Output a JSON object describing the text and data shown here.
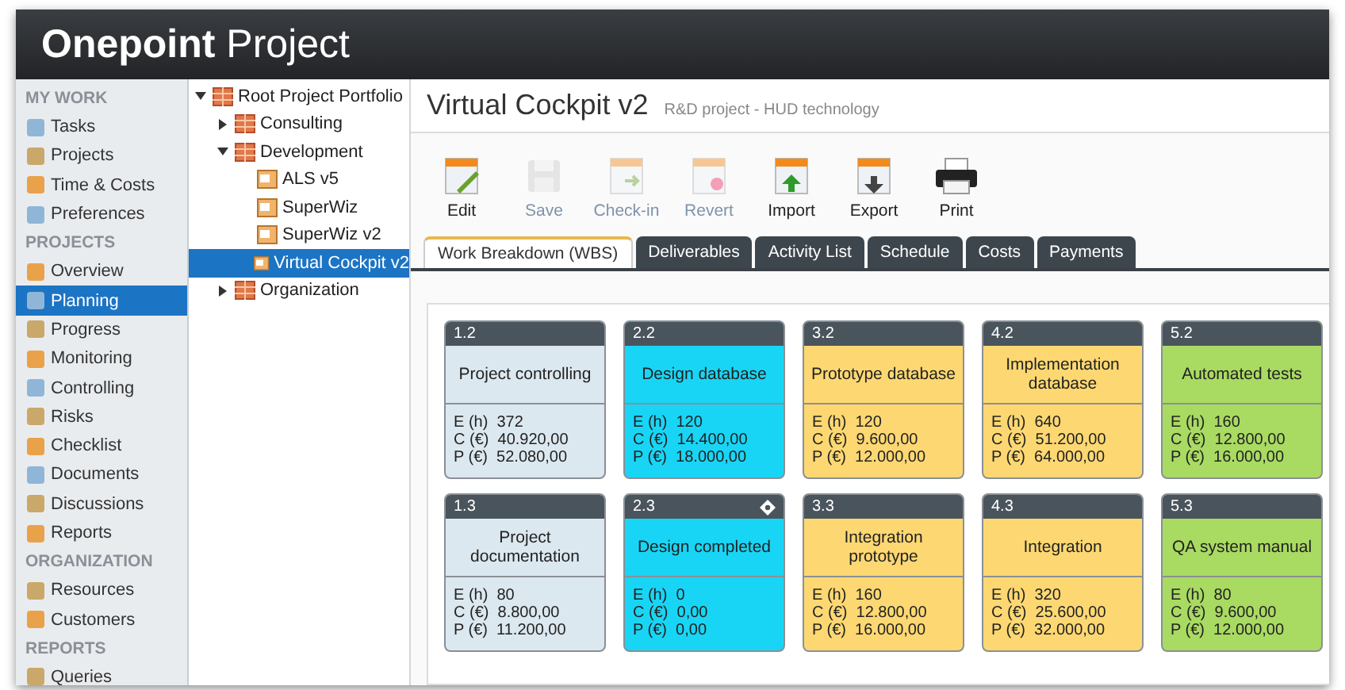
{
  "app": {
    "logo_bold": "Onepoint",
    "logo_light": "Project"
  },
  "sidebar": {
    "items": [
      {
        "kind": "header",
        "label": "MY WORK"
      },
      {
        "kind": "item",
        "label": "Tasks",
        "selected": false
      },
      {
        "kind": "item",
        "label": "Projects",
        "selected": false
      },
      {
        "kind": "item",
        "label": "Time & Costs",
        "selected": false
      },
      {
        "kind": "item",
        "label": "Preferences",
        "selected": false
      },
      {
        "kind": "header",
        "label": "PROJECTS"
      },
      {
        "kind": "item",
        "label": "Overview",
        "selected": false
      },
      {
        "kind": "item",
        "label": "Planning",
        "selected": true
      },
      {
        "kind": "item",
        "label": "Progress",
        "selected": false
      },
      {
        "kind": "item",
        "label": "Monitoring",
        "selected": false
      },
      {
        "kind": "item",
        "label": "Controlling",
        "selected": false
      },
      {
        "kind": "item",
        "label": "Risks",
        "selected": false
      },
      {
        "kind": "item",
        "label": "Checklist",
        "selected": false
      },
      {
        "kind": "item",
        "label": "Documents",
        "selected": false
      },
      {
        "kind": "item",
        "label": "Discussions",
        "selected": false
      },
      {
        "kind": "item",
        "label": "Reports",
        "selected": false
      },
      {
        "kind": "header",
        "label": "ORGANIZATION"
      },
      {
        "kind": "item",
        "label": "Resources",
        "selected": false
      },
      {
        "kind": "item",
        "label": "Customers",
        "selected": false
      },
      {
        "kind": "header",
        "label": "REPORTS"
      },
      {
        "kind": "item",
        "label": "Queries",
        "selected": false
      }
    ]
  },
  "tree": [
    {
      "label": "Root Project Portfolio",
      "kind": "portfolio",
      "expanded": true,
      "selected": false,
      "children": [
        {
          "label": "Consulting",
          "kind": "portfolio",
          "expanded": false,
          "selected": false
        },
        {
          "label": "Development",
          "kind": "portfolio",
          "expanded": true,
          "selected": false,
          "children": [
            {
              "label": "ALS v5",
              "kind": "project",
              "selected": false
            },
            {
              "label": "SuperWiz",
              "kind": "project",
              "selected": false
            },
            {
              "label": "SuperWiz v2",
              "kind": "project",
              "selected": false
            },
            {
              "label": "Virtual Cockpit v2",
              "kind": "project",
              "selected": true
            }
          ]
        },
        {
          "label": "Organization",
          "kind": "portfolio",
          "expanded": false,
          "selected": false
        }
      ]
    }
  ],
  "project": {
    "title": "Virtual Cockpit v2",
    "subtitle": "R&D project - HUD technology"
  },
  "toolbar": [
    {
      "label": "Edit",
      "kind": "edit",
      "disabled": false
    },
    {
      "label": "Save",
      "kind": "save",
      "disabled": true
    },
    {
      "label": "Check-in",
      "kind": "checkin",
      "disabled": true
    },
    {
      "label": "Revert",
      "kind": "revert",
      "disabled": true
    },
    {
      "label": "Import",
      "kind": "import",
      "disabled": false
    },
    {
      "label": "Export",
      "kind": "export",
      "disabled": false
    },
    {
      "label": "Print",
      "kind": "print",
      "disabled": false
    }
  ],
  "tabs": [
    {
      "label": "Work Breakdown (WBS)",
      "selected": true
    },
    {
      "label": "Deliverables",
      "selected": false
    },
    {
      "label": "Activity List",
      "selected": false
    },
    {
      "label": "Schedule",
      "selected": false
    },
    {
      "label": "Costs",
      "selected": false
    },
    {
      "label": "Payments",
      "selected": false
    }
  ],
  "wbs": [
    {
      "number": "1.2",
      "title": "Project controlling",
      "milestone": false,
      "color": "#dce8ef",
      "effort": "E (h)  372",
      "cost": "C (€)  40.920,00",
      "proceeds": "P (€)  52.080,00"
    },
    {
      "number": "2.2",
      "title": "Design database",
      "milestone": false,
      "color": "#19d5f5",
      "effort": "E (h)  120",
      "cost": "C (€)  14.400,00",
      "proceeds": "P (€)  18.000,00"
    },
    {
      "number": "3.2",
      "title": "Prototype database",
      "milestone": false,
      "color": "#fdd872",
      "effort": "E (h)  120",
      "cost": "C (€)  9.600,00",
      "proceeds": "P (€)  12.000,00"
    },
    {
      "number": "4.2",
      "title": "Implementation database",
      "milestone": false,
      "color": "#fdd872",
      "effort": "E (h)  640",
      "cost": "C (€)  51.200,00",
      "proceeds": "P (€)  64.000,00"
    },
    {
      "number": "5.2",
      "title": "Automated tests",
      "milestone": false,
      "color": "#a9da62",
      "effort": "E (h)  160",
      "cost": "C (€)  12.800,00",
      "proceeds": "P (€)  16.000,00"
    },
    {
      "number": "1.3",
      "title": "Project documentation",
      "milestone": false,
      "color": "#dce8ef",
      "effort": "E (h)  80",
      "cost": "C (€)  8.800,00",
      "proceeds": "P (€)  11.200,00"
    },
    {
      "number": "2.3",
      "title": "Design completed",
      "milestone": true,
      "color": "#19d5f5",
      "effort": "E (h)  0",
      "cost": "C (€)  0,00",
      "proceeds": "P (€)  0,00"
    },
    {
      "number": "3.3",
      "title": "Integration prototype",
      "milestone": false,
      "color": "#fdd872",
      "effort": "E (h)  160",
      "cost": "C (€)  12.800,00",
      "proceeds": "P (€)  16.000,00"
    },
    {
      "number": "4.3",
      "title": "Integration",
      "milestone": false,
      "color": "#fdd872",
      "effort": "E (h)  320",
      "cost": "C (€)  25.600,00",
      "proceeds": "P (€)  32.000,00"
    },
    {
      "number": "5.3",
      "title": "QA system manual",
      "milestone": false,
      "color": "#a9da62",
      "effort": "E (h)  80",
      "cost": "C (€)  9.600,00",
      "proceeds": "P (€)  12.000,00"
    }
  ]
}
